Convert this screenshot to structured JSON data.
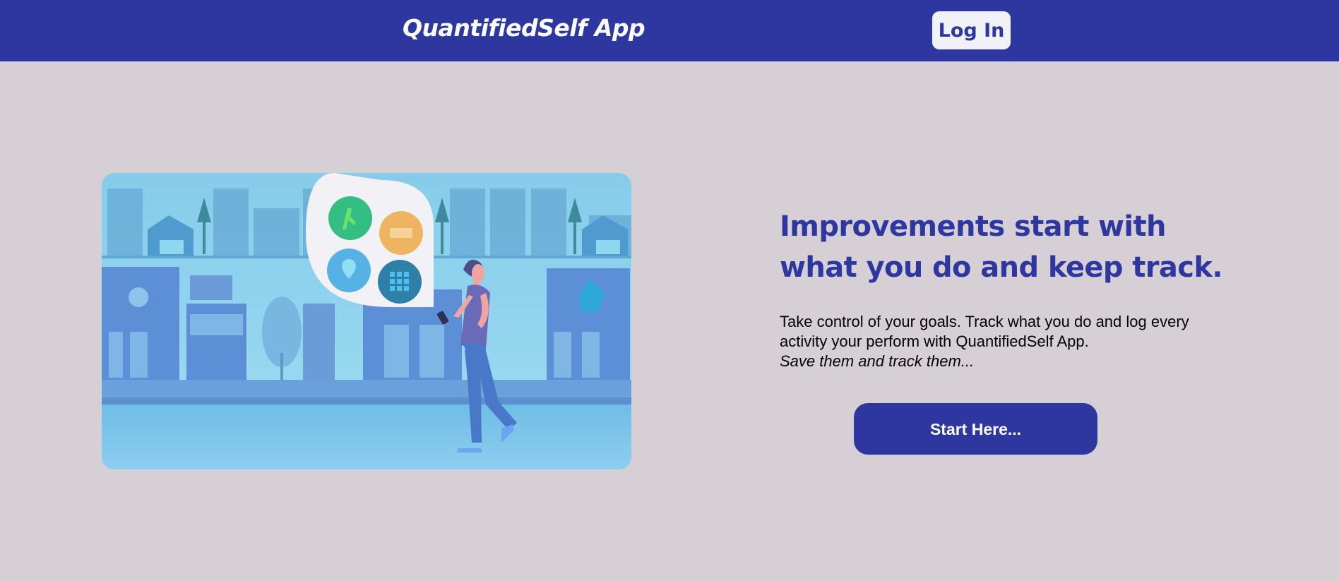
{
  "header": {
    "brand": "QuantifiedSelf App",
    "login_label": "Log In"
  },
  "hero": {
    "headline": "Improvements start with what you do and keep track.",
    "description": "Take control of your goals. Track what you do and log every activity your perform with QuantifiedSelf App.",
    "tagline": "Save them and track them...",
    "cta_label": "Start Here..."
  },
  "illustration": {
    "icons": [
      "walking-icon",
      "bed-icon",
      "location-pin-icon",
      "grid-icon"
    ]
  },
  "colors": {
    "primary": "#2e37a0",
    "background": "#d6cfd6",
    "button_light": "#f1f1f8"
  }
}
